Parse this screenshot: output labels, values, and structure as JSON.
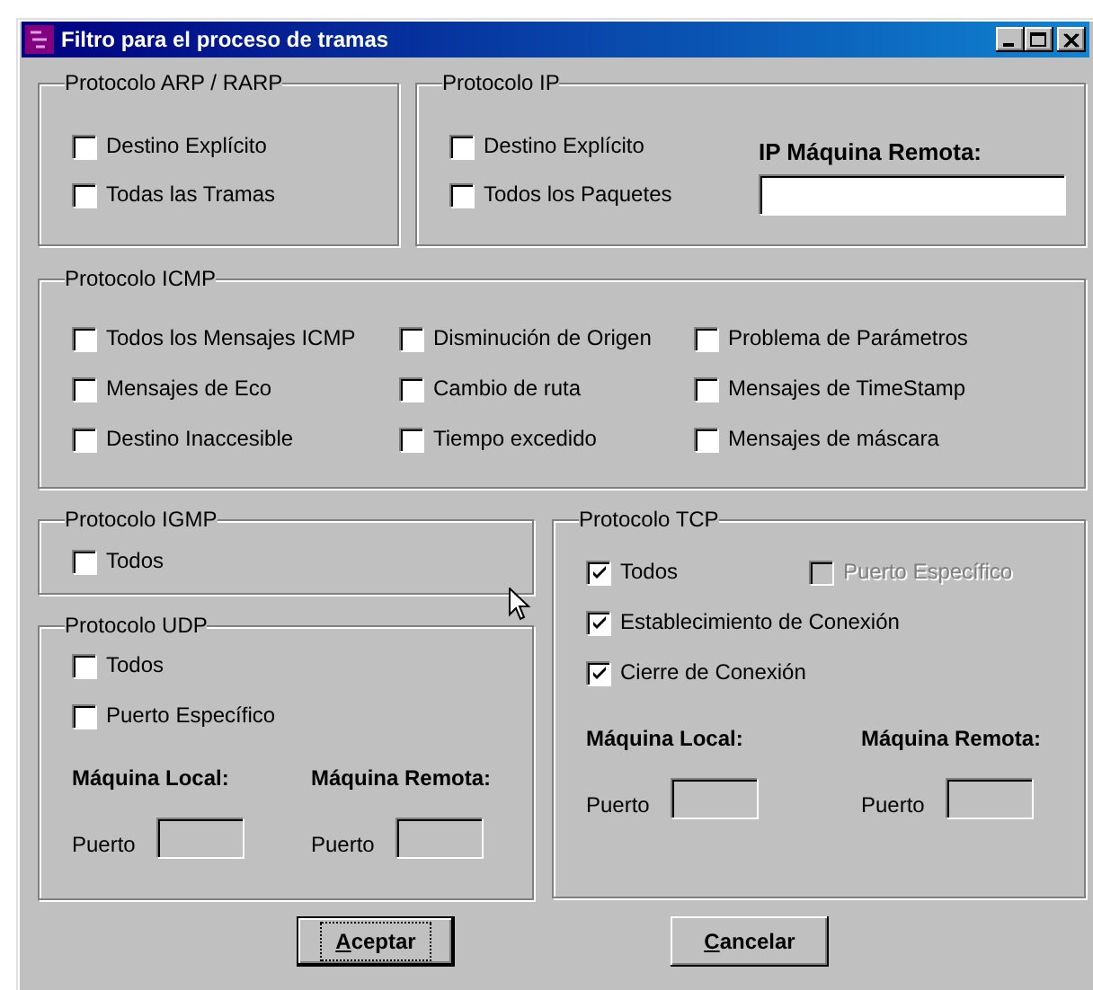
{
  "window": {
    "title": "Filtro para el proceso de tramas"
  },
  "arp": {
    "title": "Protocolo ARP / RARP",
    "checkboxes": [
      {
        "label": "Destino Explícito",
        "checked": false,
        "disabled": false
      },
      {
        "label": "Todas las Tramas",
        "checked": false,
        "disabled": false
      }
    ]
  },
  "ip": {
    "title": "Protocolo IP",
    "checkboxes": [
      {
        "label": "Destino Explícito",
        "checked": false,
        "disabled": false
      },
      {
        "label": "Todos los Paquetes",
        "checked": false,
        "disabled": false
      }
    ],
    "field_label": "IP Máquina Remota:"
  },
  "icmp": {
    "title": "Protocolo ICMP",
    "checkboxes": [
      {
        "label": "Todos los Mensajes ICMP",
        "checked": false,
        "disabled": false
      },
      {
        "label": "Disminución de Origen",
        "checked": false,
        "disabled": false
      },
      {
        "label": "Problema de Parámetros",
        "checked": false,
        "disabled": false
      },
      {
        "label": "Mensajes de Eco",
        "checked": false,
        "disabled": false
      },
      {
        "label": "Cambio de ruta",
        "checked": false,
        "disabled": false
      },
      {
        "label": "Mensajes de TimeStamp",
        "checked": false,
        "disabled": false
      },
      {
        "label": "Destino Inaccesible",
        "checked": false,
        "disabled": false
      },
      {
        "label": "Tiempo excedido",
        "checked": false,
        "disabled": false
      },
      {
        "label": "Mensajes de máscara",
        "checked": false,
        "disabled": false
      }
    ]
  },
  "igmp": {
    "title": "Protocolo IGMP",
    "checkboxes": [
      {
        "label": "Todos",
        "checked": false,
        "disabled": false
      }
    ]
  },
  "udp": {
    "title": "Protocolo UDP",
    "checkboxes": [
      {
        "label": "Todos",
        "checked": false,
        "disabled": false
      },
      {
        "label": "Puerto Específico",
        "checked": false,
        "disabled": false
      }
    ],
    "ports": [
      {
        "heading": "Máquina Local:",
        "label": "Puerto"
      },
      {
        "heading": "Máquina Remota:",
        "label": "Puerto"
      }
    ]
  },
  "tcp": {
    "title": "Protocolo TCP",
    "checkboxes": [
      {
        "label": "Todos",
        "checked": true,
        "disabled": false
      },
      {
        "label": "Puerto Específico",
        "checked": false,
        "disabled": true
      },
      {
        "label": "Establecimiento de Conexión",
        "checked": true,
        "disabled": false
      },
      {
        "label": "Cierre de Conexión",
        "checked": true,
        "disabled": false
      }
    ],
    "ports": [
      {
        "heading": "Máquina Local:",
        "label": "Puerto"
      },
      {
        "heading": "Máquina Remota:",
        "label": "Puerto"
      }
    ]
  },
  "buttons": [
    {
      "label": "Aceptar",
      "focused": true
    },
    {
      "label": "Cancelar",
      "focused": false
    }
  ]
}
